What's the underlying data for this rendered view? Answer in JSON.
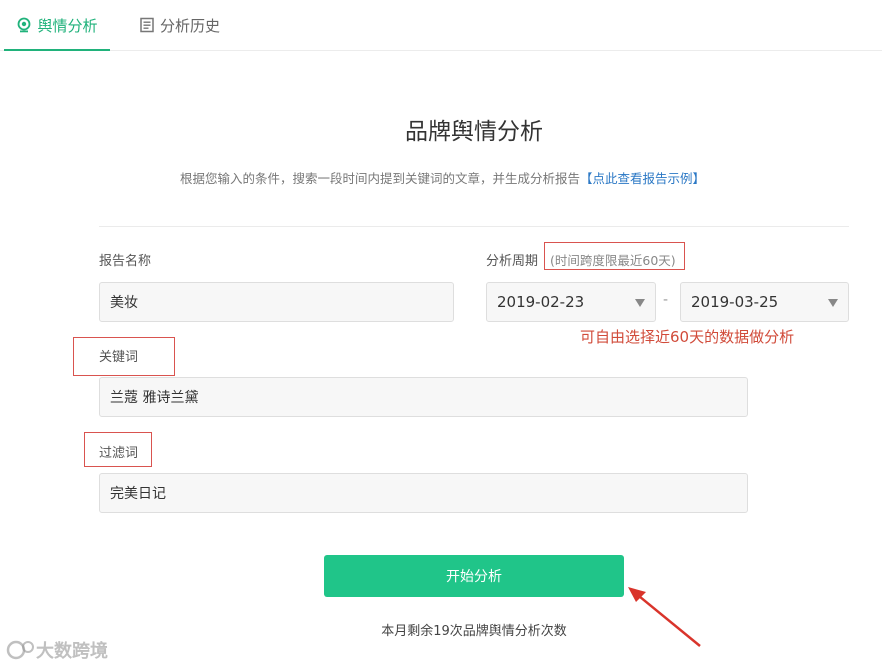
{
  "tabs": [
    {
      "label": "舆情分析",
      "icon": "location-pin-icon",
      "active": true
    },
    {
      "label": "分析历史",
      "icon": "document-icon",
      "active": false
    }
  ],
  "page_title": "品牌舆情分析",
  "description": {
    "text": "根据您输入的条件，搜索一段时间内提到关键词的文章，并生成分析报告",
    "link": "【点此查看报告示例】"
  },
  "form": {
    "report_name": {
      "label": "报告名称",
      "value": "美妆"
    },
    "period": {
      "label": "分析周期",
      "hint": "(时间跨度限最近60天)",
      "start": "2019-02-23",
      "separator": "-",
      "end": "2019-03-25"
    },
    "keywords": {
      "label": "关键词",
      "value": "兰蔻 雅诗兰黛"
    },
    "filter": {
      "label": "过滤词",
      "value": "完美日记"
    }
  },
  "annotation": "可自由选择近60天的数据做分析",
  "start_button": "开始分析",
  "remaining_text": "本月剩余19次品牌舆情分析次数",
  "watermark": "大数跨境",
  "colors": {
    "accent": "#20c589",
    "active_tab": "#20b27b",
    "link": "#2b78c5",
    "annotation": "#d14b3a"
  }
}
